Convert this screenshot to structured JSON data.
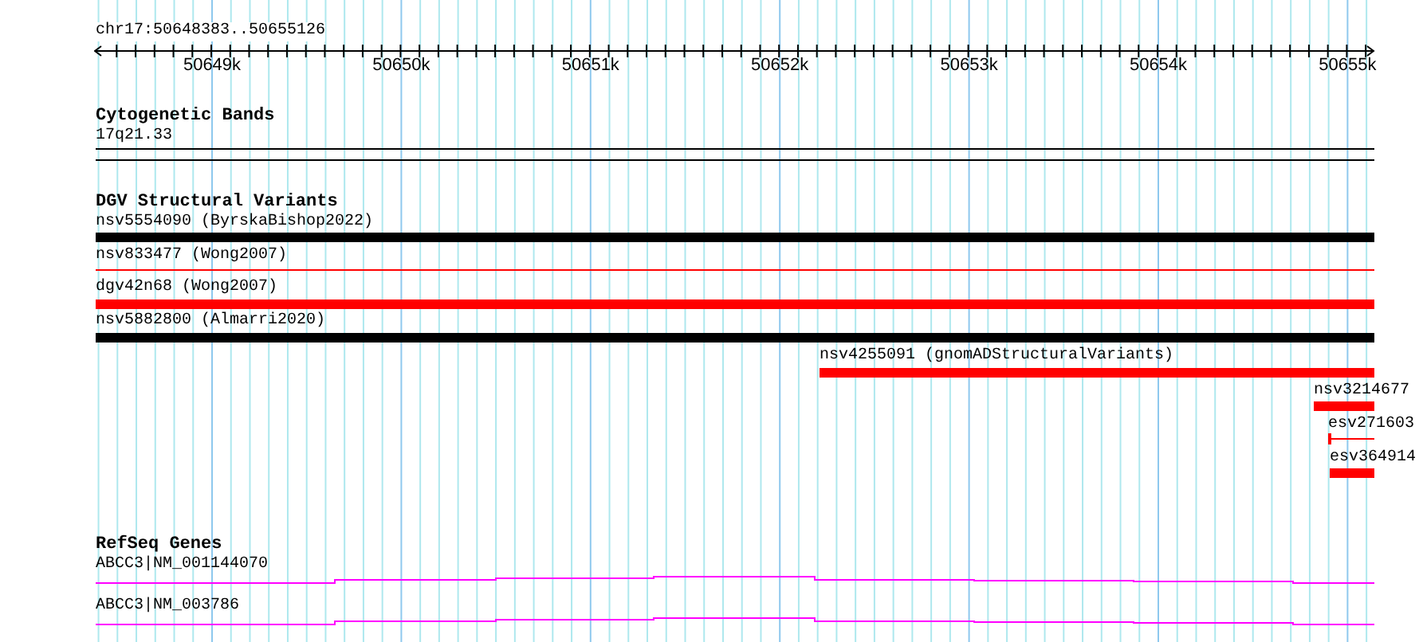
{
  "ruler": {
    "location": "chr17:50648383..50655126",
    "ticks": [
      "50649k",
      "50650k",
      "50651k",
      "50652k",
      "50653k",
      "50654k",
      "50655k"
    ]
  },
  "tracks": [
    {
      "kind": "bands",
      "title": "Cytogenetic Bands",
      "features": [
        {
          "label": "17q21.33"
        }
      ]
    },
    {
      "kind": "variants",
      "title": "DGV Structural Variants",
      "features": [
        {
          "label": "nsv5554090 (ByrskaBishop2022)",
          "color": "#000000",
          "kind": "bar"
        },
        {
          "label": "nsv833477 (Wong2007)",
          "color": "#ff0000",
          "kind": "line"
        },
        {
          "label": "dgv42n68 (Wong2007)",
          "color": "#ff0000",
          "kind": "bar"
        },
        {
          "label": "nsv5882800 (Almarri2020)",
          "color": "#000000",
          "kind": "bar"
        },
        {
          "label": "nsv4255091 (gnomADStructuralVariants)",
          "color": "#ff0000",
          "kind": "bar"
        },
        {
          "label": "nsv3214677",
          "color": "#ff0000",
          "kind": "bar"
        },
        {
          "label": "esv271603",
          "color": "#ff0000",
          "kind": "line"
        },
        {
          "label": "esv364914",
          "color": "#ff0000",
          "kind": "bar"
        }
      ]
    },
    {
      "kind": "genes",
      "title": "RefSeq Genes",
      "features": [
        {
          "label": "ABCC3|NM_001144070"
        },
        {
          "label": "ABCC3|NM_003786"
        }
      ]
    }
  ]
}
